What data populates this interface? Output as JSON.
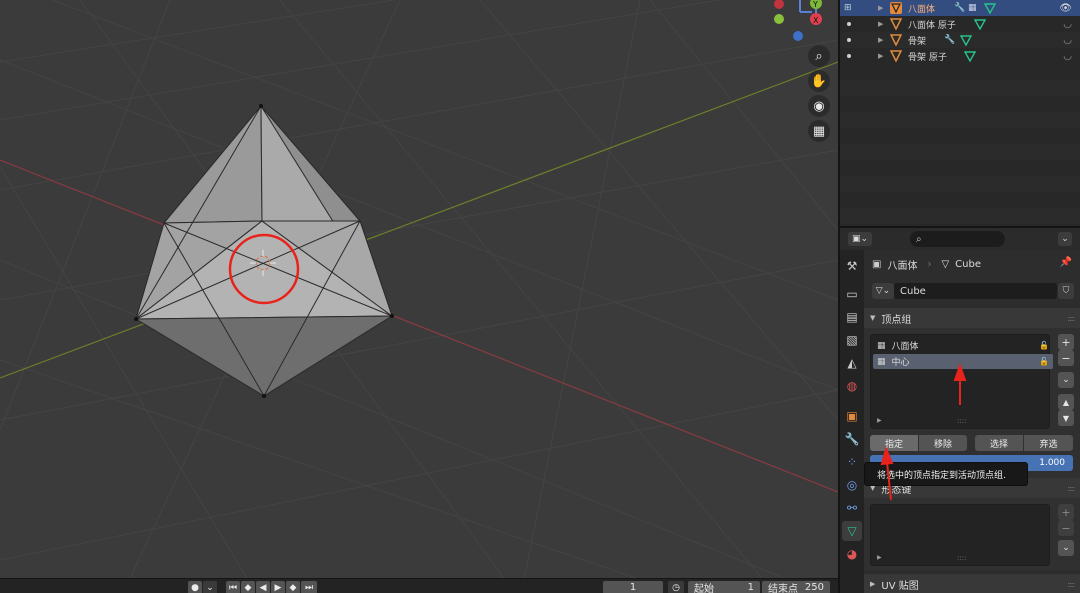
{
  "outliner": {
    "rows": [
      {
        "label": "八面体",
        "selected": true
      },
      {
        "label": "八面体 原子",
        "selected": false
      },
      {
        "label": "骨架",
        "selected": false
      },
      {
        "label": "骨架 原子",
        "selected": false
      }
    ]
  },
  "properties": {
    "breadcrumb_object": "八面体",
    "breadcrumb_mesh": "Cube",
    "mesh_name": "Cube",
    "vertex_groups_title": "顶点组",
    "vertex_groups": [
      {
        "name": "八面体",
        "active": false
      },
      {
        "name": "中心",
        "active": true
      }
    ],
    "buttons": {
      "assign": "指定",
      "remove": "移除",
      "select": "选择",
      "deselect": "弃选"
    },
    "weight_value": "1.000",
    "tooltip": "将选中的顶点指定到活动顶点组.",
    "shape_keys_title": "形态键",
    "uv_maps_title": "UV 贴图"
  },
  "timeline": {
    "current_frame": "1",
    "start_label": "起始",
    "start_value": "1",
    "end_label": "结束点",
    "end_value": "250"
  },
  "gizmo": {
    "y_label": "Y",
    "x_label": "X"
  },
  "colors": {
    "accent_blue": "#4772b3",
    "selection_row": "#334d80",
    "annotation_red": "#e8231c",
    "mesh_icon_green": "#27c48a",
    "object_icon_orange": "#e58a3b"
  }
}
